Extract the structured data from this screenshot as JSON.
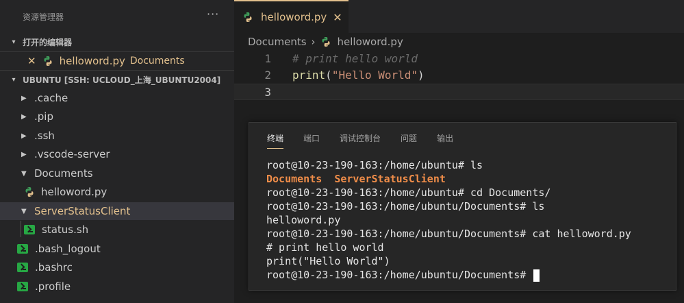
{
  "sidebar": {
    "title": "资源管理器",
    "more": "···",
    "open_editors": {
      "header": "打开的编辑器",
      "file_name": "helloword.py",
      "file_dir": "Documents"
    },
    "workspace": {
      "header": "UBUNTU [SSH: UCLOUD_上海_UBUNTU2004]",
      "items": [
        {
          "label": ".cache",
          "kind": "folder",
          "expanded": false
        },
        {
          "label": ".pip",
          "kind": "folder",
          "expanded": false
        },
        {
          "label": ".ssh",
          "kind": "folder",
          "expanded": false
        },
        {
          "label": ".vscode-server",
          "kind": "folder",
          "expanded": false
        },
        {
          "label": "Documents",
          "kind": "folder",
          "expanded": true
        },
        {
          "label": "helloword.py",
          "kind": "python-file"
        },
        {
          "label": "ServerStatusClient",
          "kind": "folder",
          "expanded": true,
          "selected": true
        },
        {
          "label": "status.sh",
          "kind": "shell-file"
        },
        {
          "label": ".bash_logout",
          "kind": "shell-file"
        },
        {
          "label": ".bashrc",
          "kind": "shell-file"
        },
        {
          "label": ".profile",
          "kind": "shell-file"
        }
      ]
    }
  },
  "editor": {
    "tab_label": "helloword.py",
    "tab_close": "✕",
    "breadcrumb": {
      "folder": "Documents",
      "separator": "›",
      "file": "helloword.py"
    },
    "lines": [
      {
        "num": "1",
        "comment": "# print hello world"
      },
      {
        "num": "2",
        "fn": "print",
        "open": "(",
        "str": "\"Hello World\"",
        "close": ")"
      },
      {
        "num": "3"
      }
    ]
  },
  "panel": {
    "tabs": [
      "终端",
      "端口",
      "调试控制台",
      "问题",
      "输出"
    ],
    "active_tab": "终端",
    "terminal": {
      "line1": "root@10-23-190-163:/home/ubuntu# ls",
      "ls_dir1": "Documents",
      "ls_dir2": "ServerStatusClient",
      "line3": "root@10-23-190-163:/home/ubuntu# cd Documents/",
      "line4": "root@10-23-190-163:/home/ubuntu/Documents# ls",
      "line5": "helloword.py",
      "line6": "root@10-23-190-163:/home/ubuntu/Documents# cat helloword.py",
      "line7": "# print hello world",
      "line8": "print(\"Hello World\")",
      "line9": "root@10-23-190-163:/home/ubuntu/Documents# "
    }
  },
  "colors": {
    "accent": "#e2c08d",
    "terminal_dir": "#f08d49",
    "shell_icon": "#27a844"
  }
}
